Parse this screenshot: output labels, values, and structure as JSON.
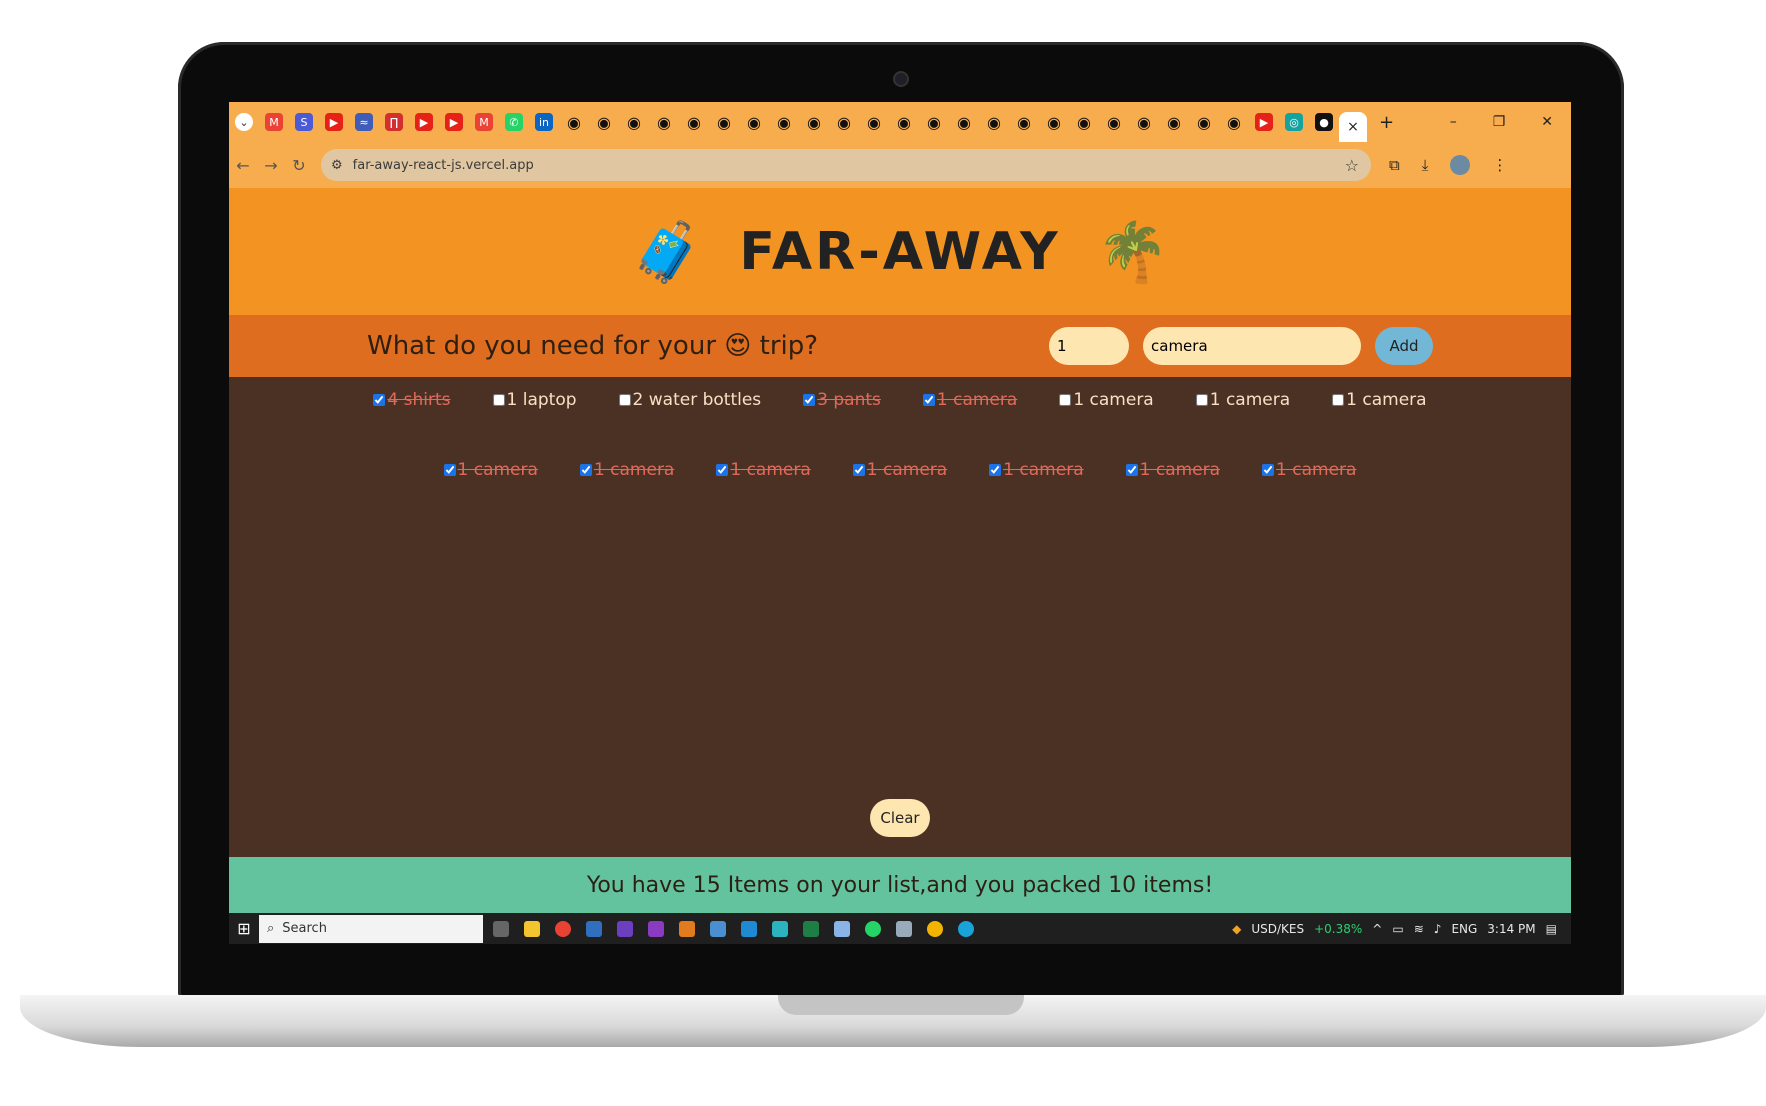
{
  "browser": {
    "url": "far-away-react-js.vercel.app",
    "active_tab_close": "×",
    "new_tab": "+",
    "window_controls": [
      "–",
      "❐",
      "✕"
    ],
    "nav": {
      "back": "←",
      "forward": "→",
      "reload": "↻"
    },
    "tab_icons": [
      {
        "name": "gmail",
        "color": "#ea4335",
        "glyph": "M"
      },
      {
        "name": "s-app",
        "color": "#4c5bd4",
        "glyph": "S"
      },
      {
        "name": "youtube",
        "color": "#e62117",
        "glyph": "▶"
      },
      {
        "name": "app",
        "color": "#3f5db8",
        "glyph": "≈"
      },
      {
        "name": "app",
        "color": "#d32f2f",
        "glyph": "∏"
      },
      {
        "name": "youtube",
        "color": "#e62117",
        "glyph": "▶"
      },
      {
        "name": "youtube",
        "color": "#e62117",
        "glyph": "▶"
      },
      {
        "name": "gmail",
        "color": "#ea4335",
        "glyph": "M"
      },
      {
        "name": "whatsapp",
        "color": "#25d366",
        "glyph": "✆"
      },
      {
        "name": "linkedin",
        "color": "#0a66c2",
        "glyph": "in"
      }
    ],
    "github_tab_count": 23
  },
  "app": {
    "title": "FAR-AWAY",
    "left_emoji": "🧳",
    "right_emoji": "🌴"
  },
  "form": {
    "question": "What do you need for your 😍 trip?",
    "quantity": "1",
    "description": "camera",
    "add_label": "Add"
  },
  "items_row1": [
    {
      "label": "4 shirts",
      "packed": true
    },
    {
      "label": "1 laptop",
      "packed": false
    },
    {
      "label": "2 water bottles",
      "packed": false
    },
    {
      "label": "3 pants",
      "packed": true
    },
    {
      "label": "1 camera",
      "packed": true
    },
    {
      "label": "1 camera",
      "packed": false
    },
    {
      "label": "1 camera",
      "packed": false
    },
    {
      "label": "1 camera",
      "packed": false
    }
  ],
  "items_row2": [
    {
      "label": "1 camera",
      "packed": true
    },
    {
      "label": "1 camera",
      "packed": true
    },
    {
      "label": "1 camera",
      "packed": true
    },
    {
      "label": "1 camera",
      "packed": true
    },
    {
      "label": "1 camera",
      "packed": true
    },
    {
      "label": "1 camera",
      "packed": true
    },
    {
      "label": "1 camera",
      "packed": true
    }
  ],
  "clear_label": "Clear",
  "footer": {
    "stats": "You have 15 Items on your list,and you packed 10 items!"
  },
  "taskbar": {
    "search_label": "Search",
    "ticker": "USD/KES",
    "ticker_change": "+0.38%",
    "lang": "ENG",
    "time": "3:14 PM"
  }
}
